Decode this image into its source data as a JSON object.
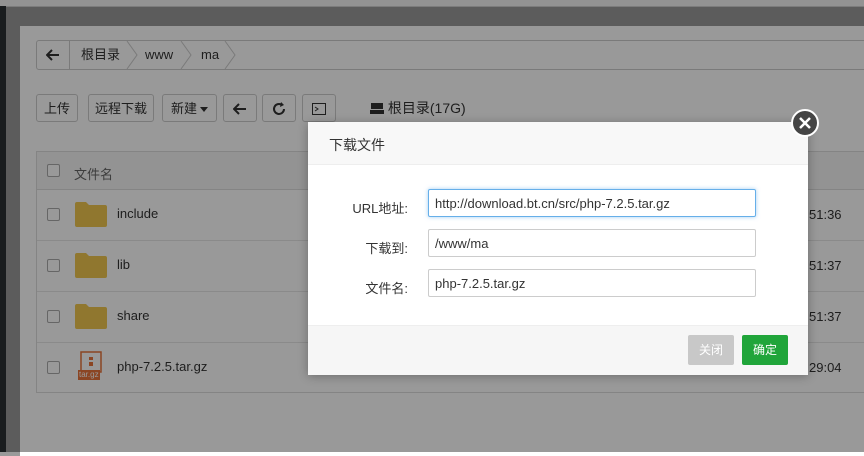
{
  "breadcrumb": {
    "items": [
      "根目录",
      "www",
      "ma"
    ]
  },
  "toolbar": {
    "upload": "上传",
    "remote_download": "远程下载",
    "new": "新建",
    "disk_label": "根目录(17G)"
  },
  "table": {
    "header_name": "文件名",
    "rows": [
      {
        "name": "include",
        "time": "51:36",
        "type": "folder"
      },
      {
        "name": "lib",
        "time": "51:37",
        "type": "folder"
      },
      {
        "name": "share",
        "time": "51:37",
        "type": "folder"
      },
      {
        "name": "php-7.2.5.tar.gz",
        "time": "29:04",
        "type": "archive",
        "badge": "tar.gz"
      }
    ]
  },
  "dialog": {
    "title": "下载文件",
    "url_label": "URL地址:",
    "url_value": "http://download.bt.cn/src/php-7.2.5.tar.gz",
    "dest_label": "下载到:",
    "dest_value": "/www/ma",
    "filename_label": "文件名:",
    "filename_value": "php-7.2.5.tar.gz",
    "cancel": "关闭",
    "ok": "确定"
  },
  "colors": {
    "accent": "#20a53a",
    "folder": "#f0c74f",
    "archive": "#e8743b"
  }
}
